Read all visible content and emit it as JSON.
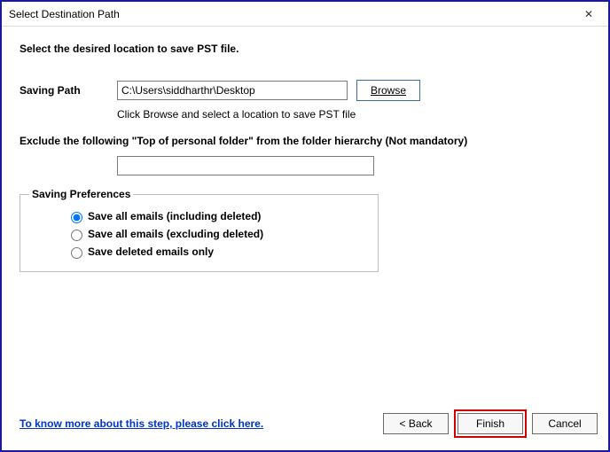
{
  "window": {
    "title": "Select Destination Path",
    "close_glyph": "✕"
  },
  "body": {
    "instruction": "Select the desired location to save PST file.",
    "saving_path_label": "Saving Path",
    "saving_path_value": "C:\\Users\\siddharthr\\Desktop",
    "browse_label": "Browse",
    "browse_hint": "Click Browse and select a location to save PST file",
    "exclude_label": "Exclude the following \"Top of personal folder\" from the folder hierarchy  (Not mandatory)",
    "exclude_value": ""
  },
  "prefs": {
    "legend": "Saving Preferences",
    "options": [
      "Save all emails (including deleted)",
      "Save all emails (excluding deleted)",
      "Save deleted emails only"
    ],
    "selected_index": 0
  },
  "footer": {
    "help_link": "To know more about this step, please click here.",
    "back": "< Back",
    "finish": "Finish",
    "cancel": "Cancel"
  }
}
